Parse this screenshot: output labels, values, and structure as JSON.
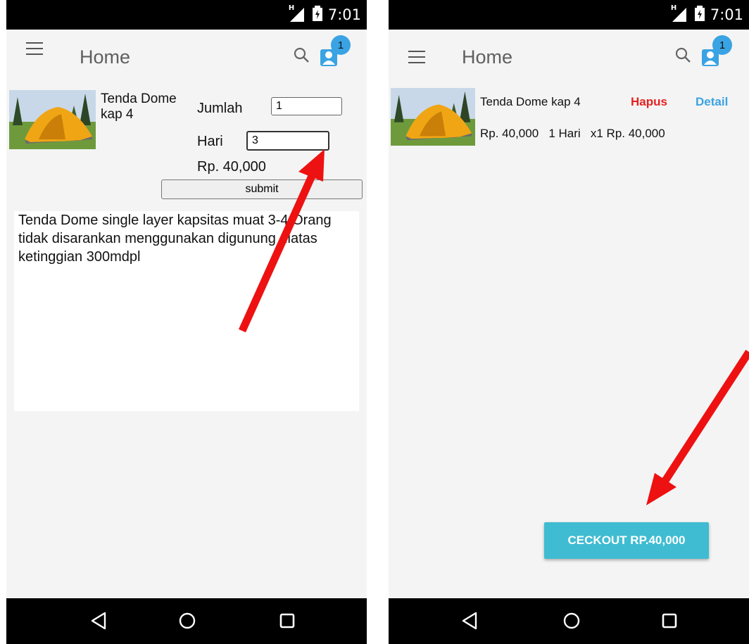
{
  "status_bar": {
    "network": "H",
    "time": "7:01"
  },
  "toolbar": {
    "title": "Home",
    "badge_count": "1"
  },
  "detail_screen": {
    "product_name": "Tenda Dome kap 4",
    "jumlah_label": "Jumlah",
    "jumlah_value": "1",
    "hari_label": "Hari",
    "hari_value": "3",
    "price": "Rp. 40,000",
    "submit_label": "submit",
    "description": "Tenda Dome single layer kapsitas muat 3-4 Orang tidak disarankan menggunakan digunung diatas ketinggian 300mdpl"
  },
  "cart_screen": {
    "item_name": "Tenda Dome kap 4",
    "hapus_label": "Hapus",
    "detail_label": "Detail",
    "item_meta": "Rp. 40,000   1 Hari   x1 Rp. 40,000",
    "checkout_label": "CECKOUT RP.40,000"
  },
  "colors": {
    "accent_blue": "#3aa3e3",
    "delete_red": "#e52121",
    "checkout_bg": "#3fbcd1",
    "annotation_arrow": "#ee1111"
  },
  "icons": [
    "menu-icon",
    "search-icon",
    "user-icon",
    "back-icon",
    "home-icon",
    "recents-icon",
    "signal-icon",
    "battery-icon"
  ]
}
